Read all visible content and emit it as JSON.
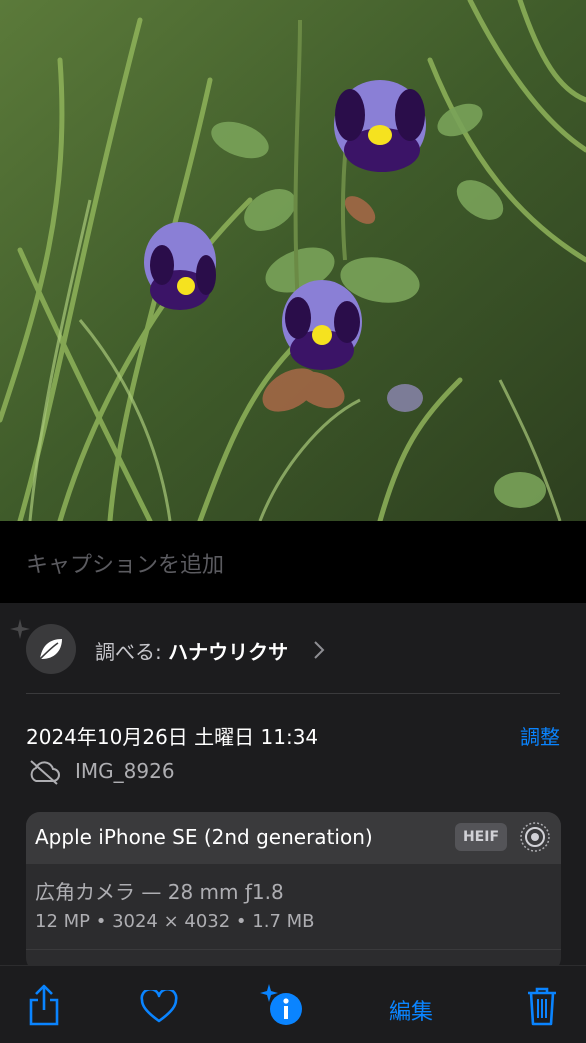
{
  "photo": {
    "subject": "flower-photo"
  },
  "caption": {
    "placeholder": "キャプションを追加"
  },
  "lookup": {
    "prefix": "調べる: ",
    "name": "ハナウリクサ"
  },
  "meta": {
    "datetime": "2024年10月26日 土曜日 11:34",
    "adjust_label": "調整",
    "filename": "IMG_8926"
  },
  "camera": {
    "device": "Apple iPhone SE (2nd generation)",
    "format": "HEIF",
    "lens": "広角カメラ — 28 mm ƒ1.8",
    "specs": "12 MP  •  3024 × 4032  •  1.7 MB"
  },
  "toolbar": {
    "edit_label": "編集"
  },
  "icons": {
    "share": "share-icon",
    "favorite": "heart-icon",
    "info": "info-sparkle-icon",
    "delete": "trash-icon",
    "cloud_off": "cloud-off-icon"
  },
  "colors": {
    "accent": "#0a84ff",
    "panel": "#1c1c1e",
    "card": "#2c2c2e",
    "card_header": "#3a3a3c"
  }
}
